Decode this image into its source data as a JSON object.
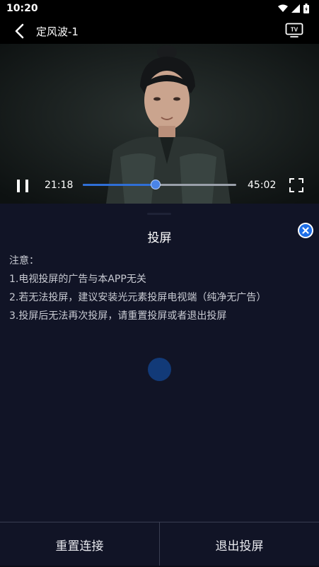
{
  "status_bar": {
    "time": "10:20",
    "icons": [
      "wifi-icon",
      "signal-icon",
      "battery-icon"
    ]
  },
  "header": {
    "title": "定风波-1",
    "back_icon": "chevron-left-icon",
    "tv_icon": "tv-icon",
    "tv_icon_label": "TV"
  },
  "player": {
    "current_time": "21:18",
    "total_time": "45:02",
    "progress": 0.473,
    "state": "playing",
    "accent_color": "#2f6fd6"
  },
  "cast_panel": {
    "title": "投屏",
    "notice_heading": "注意：",
    "notices": [
      "1.电视投屏的广告与本APP无关",
      "2.若无法投屏，建议安装光元素投屏电视端（纯净无广告）",
      "3.投屏后无法再次投屏，请重置投屏或者退出投屏"
    ],
    "loading": true
  },
  "actions": {
    "reset_label": "重置连接",
    "exit_label": "退出投屏"
  }
}
